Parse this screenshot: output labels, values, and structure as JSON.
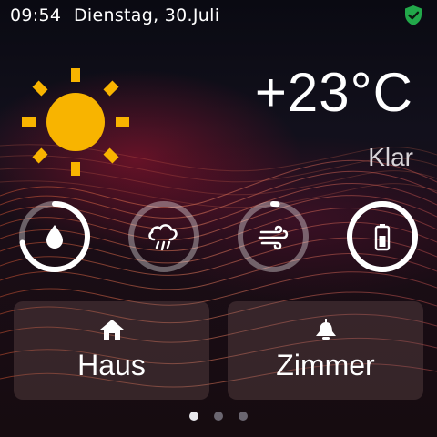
{
  "status": {
    "time": "09:54",
    "date": "Dienstag, 30.Juli",
    "security_icon": "shield-check-icon",
    "security_color": "#22a84a"
  },
  "weather": {
    "icon": "sun-icon",
    "temperature": "+23°C",
    "condition": "Klar",
    "sun_color": "#f8b400"
  },
  "indicators": [
    {
      "name": "humidity",
      "icon": "water-drop-icon",
      "level": 0.72
    },
    {
      "name": "precipitation",
      "icon": "cloud-rain-icon",
      "level": 0.0
    },
    {
      "name": "wind",
      "icon": "wind-icon",
      "level": 0.02
    },
    {
      "name": "battery",
      "icon": "battery-icon",
      "level": 1.0
    }
  ],
  "tiles": [
    {
      "label": "Haus",
      "icon": "home-icon"
    },
    {
      "label": "Zimmer",
      "icon": "bell-icon"
    }
  ],
  "pagination": {
    "pages": 3,
    "active": 0
  }
}
